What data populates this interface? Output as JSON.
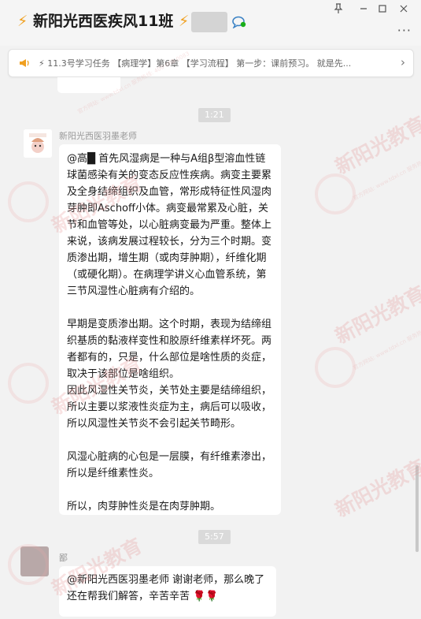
{
  "window": {
    "title": "新阳光西医疾风11班",
    "title_icon": "lightning-bolt-emoji",
    "pin_icon": "pin-icon",
    "minimize_icon": "minimize-icon",
    "maximize_icon": "maximize-icon",
    "close_icon": "close-icon",
    "more_label": "···"
  },
  "notice": {
    "text": "⚡ 11.3号学习任务 【病理学】第6章 【学习流程】 第一步：课前预习。 就是先...",
    "chevron": "›"
  },
  "messages": [
    {
      "time": "1:21",
      "sender": "新阳光西医羽墨老师",
      "paragraphs": [
        "@高█ 首先风湿病是一种与A组β型溶血性链球菌感染有关的变态反应性疾病。病变主要累及全身结缔组织及血管，常形成特征性风湿肉芽肿即Aschoff小体。病变最常累及心脏，关节和血管等处，以心脏病变最为严重。整体上来说，该病发展过程较长，分为三个时期。变质渗出期，增生期（或肉芽肿期），纤维化期（或硬化期）。在病理学讲义心血管系统，第三节风湿性心脏病有介绍的。",
        "早期是变质渗出期。这个时期，表现为结缔组织基质的黏液样变性和胶原纤维素样坏死。两者都有的，只是，什么部位是啥性质的炎症，取决于该部位是啥组织。",
        "因此风湿性关节炎，关节处主要是结缔组织，所以主要以浆液性炎症为主，病后可以吸收，所以风湿性关节炎不会引起关节畸形。",
        "风湿心脏病的心包是一层膜，有纤维素渗出，所以是纤维素性炎。",
        "所以，肉芽肿性炎是在肉芽肿期。"
      ]
    },
    {
      "time": "5:57",
      "sender": "鄙",
      "text": "@新阳光西医羽墨老师 谢谢老师，那么晚了还在帮我们解答，辛苦辛苦",
      "emoji": "🌹🌹"
    }
  ],
  "watermark": {
    "brand": "新阳光教育",
    "sub": "官方网站: www.tdxl.cn 服务热线: 400-888-0083"
  },
  "colors": {
    "title_bolt": "#f0a020",
    "bubble_bg": "#ffffff",
    "chat_bg": "#f2f2f2",
    "rose": "#d8262c"
  }
}
